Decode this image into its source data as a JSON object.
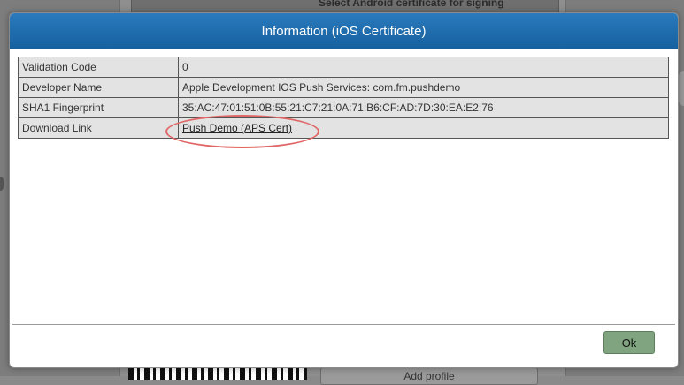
{
  "background": {
    "panel_title": "Select Android certificate for signing",
    "add_profile_label": "Add profile"
  },
  "dialog": {
    "title": "Information (iOS Certificate)",
    "rows": [
      {
        "key": "Validation Code",
        "value": "0"
      },
      {
        "key": "Developer Name",
        "value": "Apple Development IOS Push Services: com.fm.pushdemo"
      },
      {
        "key": "SHA1 Fingerprint",
        "value": "35:AC:47:01:51:0B:55:21:C7:21:0A:71:B6:CF:AD:7D:30:EA:E2:76"
      },
      {
        "key": "Download Link",
        "value": "Push Demo (APS Cert)"
      }
    ],
    "ok_label": "Ok"
  },
  "colors": {
    "header": "#1d6aa8",
    "highlight": "#e06666",
    "ok_button": "#7fa47f"
  }
}
